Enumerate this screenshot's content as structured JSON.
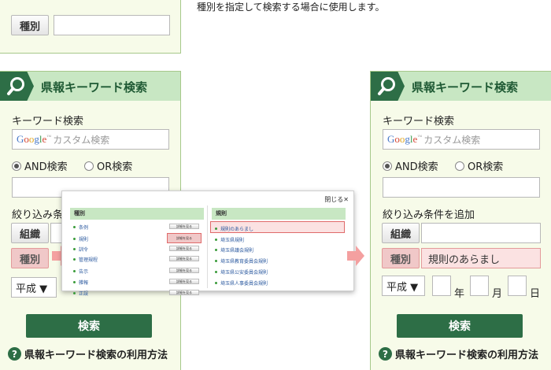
{
  "note": "種別を指定して検索する場合に使用します。",
  "top": {
    "type_button": "種別"
  },
  "left": {
    "title": "県報キーワード検索",
    "keyword_label": "キーワード検索",
    "custom_search_placeholder": "カスタム検索",
    "and_label": "AND検索",
    "or_label": "OR検索",
    "filter_label": "絞り込み条",
    "org_button": "組織",
    "type_button": "種別",
    "era_select": "平成 ▼",
    "search_button": "検索",
    "help_text": "県報キーワード検索の利用方法"
  },
  "popup": {
    "close": "閉じる✕",
    "col1_head": "種別",
    "col2_head": "規則",
    "col1_items": [
      "条例",
      "規則",
      "訓令",
      "管理規程",
      "告示",
      "雑報",
      "正誤"
    ],
    "detail_button": "詳細を見る",
    "col2_items": [
      "規則のあらまし",
      "埼玉県規則",
      "埼玉県議会規則",
      "埼玉県教育委員会規則",
      "埼玉県公安委員会規則",
      "埼玉県人事委員会規則"
    ]
  },
  "right": {
    "title": "県報キーワード検索",
    "keyword_label": "キーワード検索",
    "custom_search_placeholder": "カスタム検索",
    "and_label": "AND検索",
    "or_label": "OR検索",
    "filter_label": "絞り込み条件を追加",
    "org_button": "組織",
    "type_button": "種別",
    "type_value": "規則のあらまし",
    "era_select": "平成 ▼",
    "year_unit": "年",
    "month_unit": "月",
    "day_unit": "日",
    "search_button": "検索",
    "help_text": "県報キーワード検索の利用方法"
  },
  "colors": {
    "accent": "#2d6e46",
    "header": "#c8e7c3",
    "panel": "#f7fbe9",
    "highlight": "#f0c8c8",
    "arrow": "#f4a0a0"
  },
  "icons": [
    "search-icon",
    "help-icon",
    "radio-selected",
    "arrow-right-icon",
    "close-icon",
    "google-logo"
  ]
}
